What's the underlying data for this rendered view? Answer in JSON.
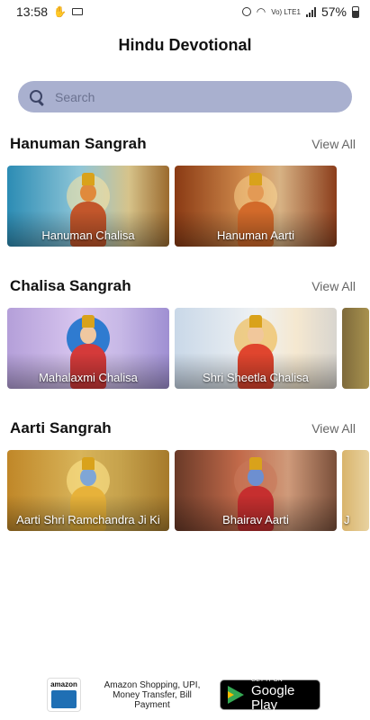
{
  "status_bar": {
    "time": "13:58",
    "battery_percent": "57%",
    "network_label": "Vo) LTE1",
    "battery_level": 0.57
  },
  "header": {
    "title": "Hindu Devotional"
  },
  "search": {
    "placeholder": "Search",
    "value": ""
  },
  "sections": [
    {
      "title": "Hanuman Sangrah",
      "view_all": "View All",
      "cards": [
        {
          "label": "Hanuman Chalisa"
        },
        {
          "label": "Hanuman Aarti"
        }
      ]
    },
    {
      "title": "Chalisa Sangrah",
      "view_all": "View All",
      "cards": [
        {
          "label": "Mahalaxmi Chalisa"
        },
        {
          "label": "Shri Sheetla Chalisa"
        }
      ]
    },
    {
      "title": "Aarti Sangrah",
      "view_all": "View All",
      "cards": [
        {
          "label": "Aarti Shri Ramchandra Ji Ki"
        },
        {
          "label": "Bhairav Aarti"
        },
        {
          "label": "J"
        }
      ]
    }
  ],
  "ad": {
    "logo_text": "amazon",
    "text": "Amazon Shopping, UPI, Money Transfer, Bill Payment",
    "badge_small": "GET IT ON",
    "badge_big": "Google Play"
  },
  "colors": {
    "search_bg": "#a9b0cf",
    "accent_text": "#111111",
    "view_all": "#666666"
  }
}
